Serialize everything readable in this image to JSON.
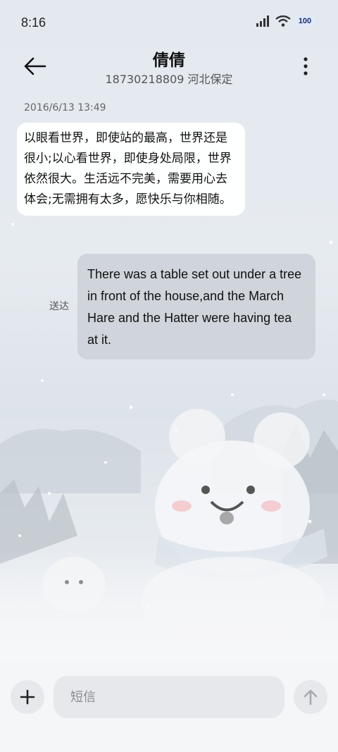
{
  "status_bar": {
    "time": "8:16",
    "battery": "100"
  },
  "header": {
    "contact_name": "倩倩",
    "contact_detail": "18730218809 河北保定"
  },
  "conversation": {
    "timestamp": "2016/6/13 13:49",
    "incoming_message": "以眼看世界，即使站的最高，世界还是很小;以心看世界，即使身处局限，世界依然很大。生活远不完美，需要用心去体会;无需拥有太多，愿快乐与你相随。",
    "outgoing_message": "There was a table set out under a tree in front of the house,and the March Hare and the Hatter were having tea at it.",
    "outgoing_status": "送达"
  },
  "composer": {
    "placeholder": "短信"
  },
  "icons": {
    "back": "back-arrow-icon",
    "more": "more-vertical-icon",
    "add": "plus-icon",
    "send": "send-arrow-up-icon",
    "signal": "signal-icon",
    "wifi": "wifi-icon"
  },
  "colors": {
    "background": "#e3e9ef",
    "incoming_bubble": "#ffffff",
    "outgoing_bubble": "#cdd2d9",
    "input_bar": "#f5f6f8"
  }
}
